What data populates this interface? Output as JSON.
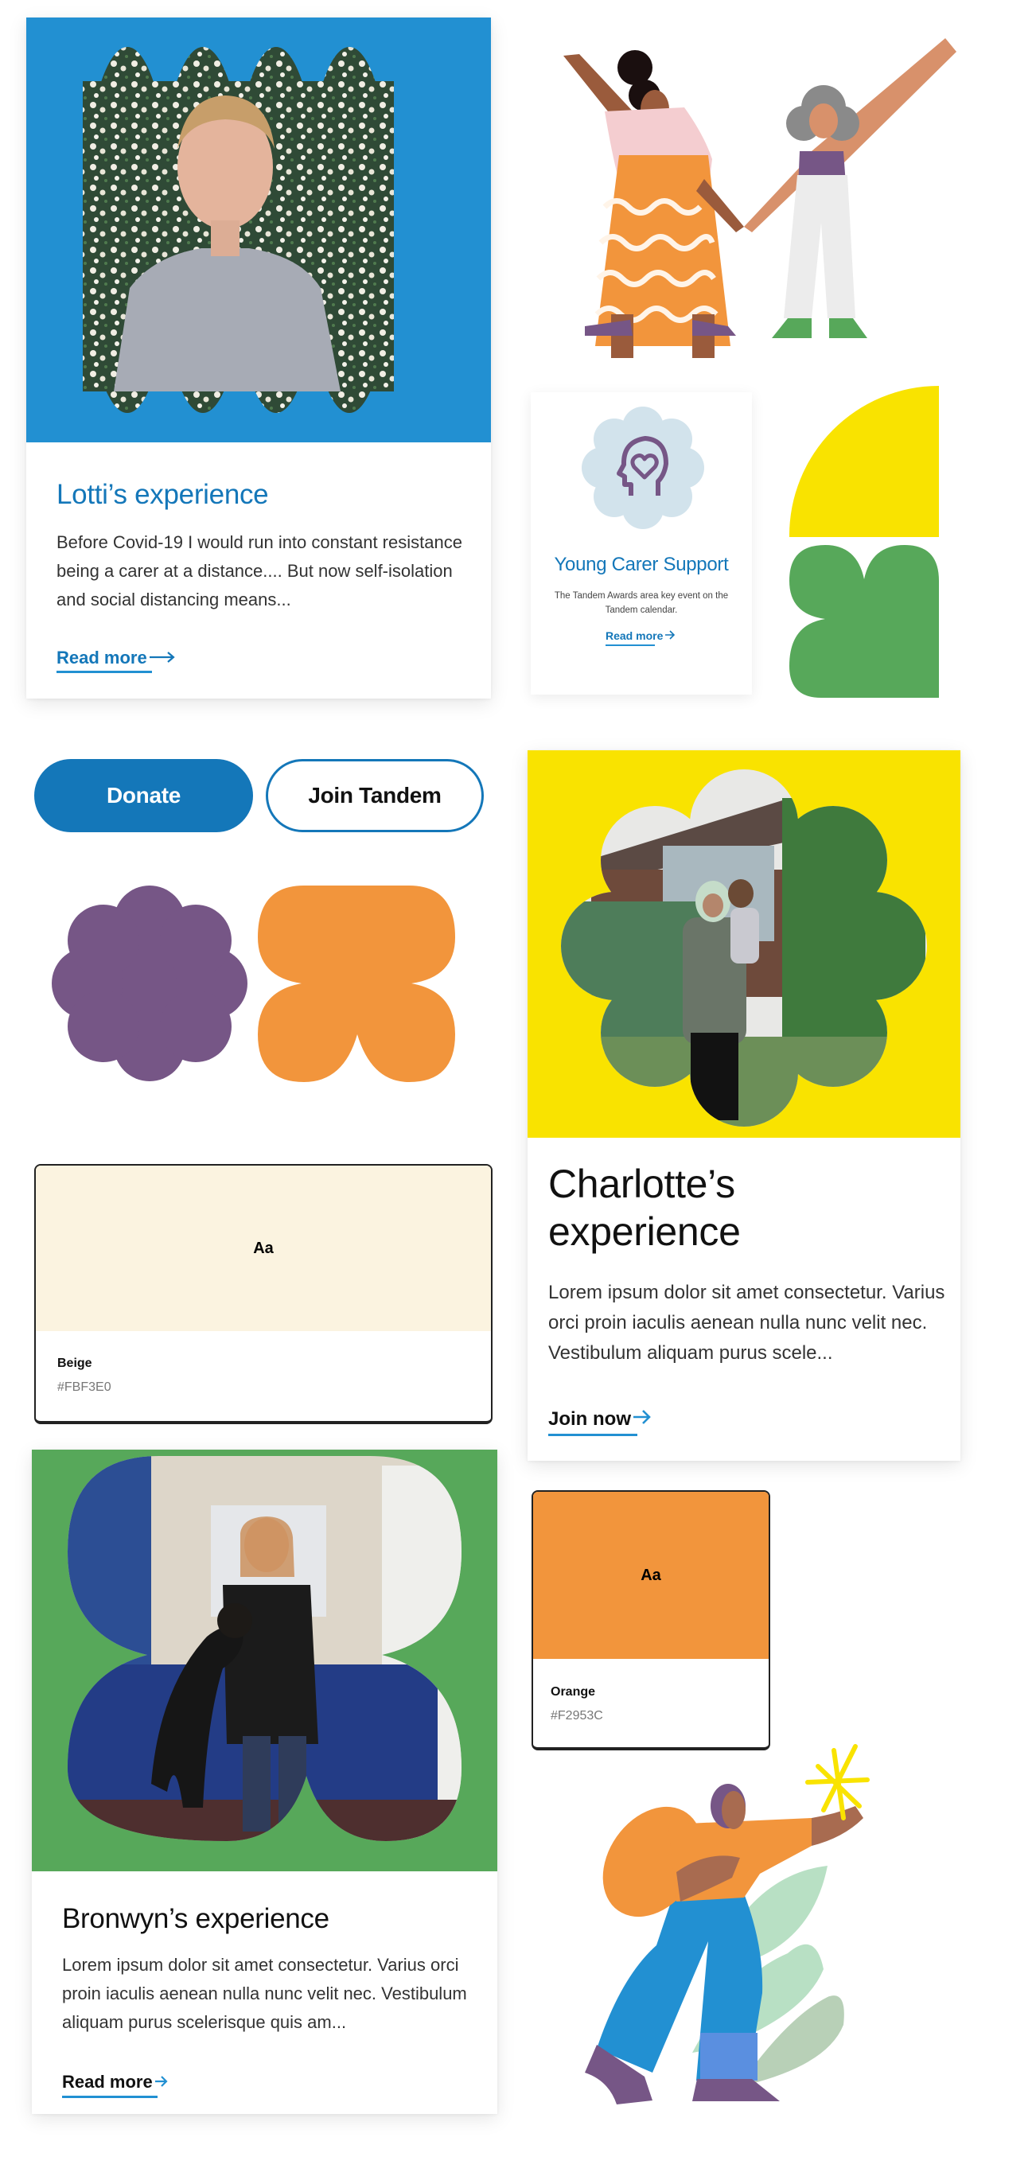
{
  "colors": {
    "blue": "#2290D2",
    "dark_blue": "#1477B9",
    "yellow": "#F9E300",
    "green": "#57A85A",
    "purple": "#765686",
    "orange": "#F2953C",
    "beige": "#FBF3E0",
    "light_blue": "#D2E3EC"
  },
  "cards": {
    "lotti": {
      "title": "Lotti’s experience",
      "excerpt": "Before Covid-19 I would run into constant resistance being a carer at a distance.... But now self-isolation and social distancing means...",
      "link": "Read more"
    },
    "young_carer": {
      "icon": "head-heart-icon",
      "title": "Young Carer Support",
      "excerpt": "The Tandem Awards area key event on the Tandem calendar.",
      "link": "Read more"
    },
    "charlotte": {
      "title": "Charlotte’s experience",
      "excerpt": "Lorem ipsum dolor sit amet consectetur. Varius orci proin iaculis aenean nulla nunc velit nec. Vestibulum aliquam purus scele...",
      "link": "Join now"
    },
    "bronwyn": {
      "title": "Bronwyn’s experience",
      "excerpt": "Lorem ipsum dolor sit amet consectetur. Varius orci proin iaculis aenean nulla nunc velit nec. Vestibulum aliquam purus scelerisque quis am...",
      "link": "Read more"
    }
  },
  "buttons": {
    "donate": "Donate",
    "join": "Join Tandem"
  },
  "swatches": [
    {
      "sample": "Aa",
      "name": "Beige",
      "hex": "#FBF3E0"
    },
    {
      "sample": "Aa",
      "name": "Orange",
      "hex": "#F2953C"
    }
  ],
  "icons": {
    "arrow": "→"
  }
}
